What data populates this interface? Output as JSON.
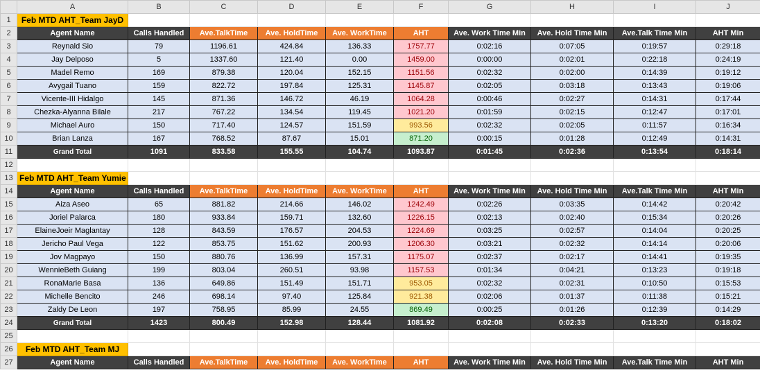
{
  "columns": [
    "A",
    "B",
    "C",
    "D",
    "E",
    "F",
    "G",
    "H",
    "I",
    "J"
  ],
  "headers": [
    "Agent Name",
    "Calls Handled",
    "Ave.TalkTime",
    "Ave. HoldTime",
    "Ave. WorkTime",
    "AHT",
    "Ave. Work Time Min",
    "Ave. Hold Time Min",
    "Ave.Talk Time Min",
    "AHT Min"
  ],
  "teams": [
    {
      "title": "Feb MTD AHT_Team JayD",
      "rows": [
        {
          "name": "Reynald Sio",
          "calls": "79",
          "talk": "1196.61",
          "hold": "424.84",
          "work": "136.33",
          "aht": "1757.77",
          "aht_status": "red",
          "work_min": "0:02:16",
          "hold_min": "0:07:05",
          "talk_min": "0:19:57",
          "aht_min": "0:29:18"
        },
        {
          "name": "Jay Delposo",
          "calls": "5",
          "talk": "1337.60",
          "hold": "121.40",
          "work": "0.00",
          "aht": "1459.00",
          "aht_status": "red",
          "work_min": "0:00:00",
          "hold_min": "0:02:01",
          "talk_min": "0:22:18",
          "aht_min": "0:24:19"
        },
        {
          "name": "Madel Remo",
          "calls": "169",
          "talk": "879.38",
          "hold": "120.04",
          "work": "152.15",
          "aht": "1151.56",
          "aht_status": "red",
          "work_min": "0:02:32",
          "hold_min": "0:02:00",
          "talk_min": "0:14:39",
          "aht_min": "0:19:12"
        },
        {
          "name": "Avygail Tuano",
          "calls": "159",
          "talk": "822.72",
          "hold": "197.84",
          "work": "125.31",
          "aht": "1145.87",
          "aht_status": "red",
          "work_min": "0:02:05",
          "hold_min": "0:03:18",
          "talk_min": "0:13:43",
          "aht_min": "0:19:06"
        },
        {
          "name": "Vicente-III Hidalgo",
          "calls": "145",
          "talk": "871.36",
          "hold": "146.72",
          "work": "46.19",
          "aht": "1064.28",
          "aht_status": "red",
          "work_min": "0:00:46",
          "hold_min": "0:02:27",
          "talk_min": "0:14:31",
          "aht_min": "0:17:44"
        },
        {
          "name": "Chezka-Alyanna Bilale",
          "calls": "217",
          "talk": "767.22",
          "hold": "134.54",
          "work": "119.45",
          "aht": "1021.20",
          "aht_status": "red",
          "work_min": "0:01:59",
          "hold_min": "0:02:15",
          "talk_min": "0:12:47",
          "aht_min": "0:17:01"
        },
        {
          "name": "Michael Auro",
          "calls": "150",
          "talk": "717.40",
          "hold": "124.57",
          "work": "151.59",
          "aht": "993.56",
          "aht_status": "yellow",
          "work_min": "0:02:32",
          "hold_min": "0:02:05",
          "talk_min": "0:11:57",
          "aht_min": "0:16:34"
        },
        {
          "name": "Brian Lanza",
          "calls": "167",
          "talk": "768.52",
          "hold": "87.67",
          "work": "15.01",
          "aht": "871.20",
          "aht_status": "green",
          "work_min": "0:00:15",
          "hold_min": "0:01:28",
          "talk_min": "0:12:49",
          "aht_min": "0:14:31"
        }
      ],
      "total": {
        "label": "Grand Total",
        "calls": "1091",
        "talk": "833.58",
        "hold": "155.55",
        "work": "104.74",
        "aht": "1093.87",
        "work_min": "0:01:45",
        "hold_min": "0:02:36",
        "talk_min": "0:13:54",
        "aht_min": "0:18:14"
      }
    },
    {
      "title": "Feb MTD AHT_Team Yumie",
      "rows": [
        {
          "name": "Aiza Aseo",
          "calls": "65",
          "talk": "881.82",
          "hold": "214.66",
          "work": "146.02",
          "aht": "1242.49",
          "aht_status": "red",
          "work_min": "0:02:26",
          "hold_min": "0:03:35",
          "talk_min": "0:14:42",
          "aht_min": "0:20:42"
        },
        {
          "name": "Joriel Palarca",
          "calls": "180",
          "talk": "933.84",
          "hold": "159.71",
          "work": "132.60",
          "aht": "1226.15",
          "aht_status": "red",
          "work_min": "0:02:13",
          "hold_min": "0:02:40",
          "talk_min": "0:15:34",
          "aht_min": "0:20:26"
        },
        {
          "name": "ElaineJoeir Maglantay",
          "calls": "128",
          "talk": "843.59",
          "hold": "176.57",
          "work": "204.53",
          "aht": "1224.69",
          "aht_status": "red",
          "work_min": "0:03:25",
          "hold_min": "0:02:57",
          "talk_min": "0:14:04",
          "aht_min": "0:20:25"
        },
        {
          "name": "Jericho Paul Vega",
          "calls": "122",
          "talk": "853.75",
          "hold": "151.62",
          "work": "200.93",
          "aht": "1206.30",
          "aht_status": "red",
          "work_min": "0:03:21",
          "hold_min": "0:02:32",
          "talk_min": "0:14:14",
          "aht_min": "0:20:06"
        },
        {
          "name": "Jov Magpayo",
          "calls": "150",
          "talk": "880.76",
          "hold": "136.99",
          "work": "157.31",
          "aht": "1175.07",
          "aht_status": "red",
          "work_min": "0:02:37",
          "hold_min": "0:02:17",
          "talk_min": "0:14:41",
          "aht_min": "0:19:35"
        },
        {
          "name": "WennieBeth Guiang",
          "calls": "199",
          "talk": "803.04",
          "hold": "260.51",
          "work": "93.98",
          "aht": "1157.53",
          "aht_status": "red",
          "work_min": "0:01:34",
          "hold_min": "0:04:21",
          "talk_min": "0:13:23",
          "aht_min": "0:19:18"
        },
        {
          "name": "RonaMarie Basa",
          "calls": "136",
          "talk": "649.86",
          "hold": "151.49",
          "work": "151.71",
          "aht": "953.05",
          "aht_status": "yellow",
          "work_min": "0:02:32",
          "hold_min": "0:02:31",
          "talk_min": "0:10:50",
          "aht_min": "0:15:53"
        },
        {
          "name": "Michelle Bencito",
          "calls": "246",
          "talk": "698.14",
          "hold": "97.40",
          "work": "125.84",
          "aht": "921.38",
          "aht_status": "yellow",
          "work_min": "0:02:06",
          "hold_min": "0:01:37",
          "talk_min": "0:11:38",
          "aht_min": "0:15:21"
        },
        {
          "name": "Zaldy De Leon",
          "calls": "197",
          "talk": "758.95",
          "hold": "85.99",
          "work": "24.55",
          "aht": "869.49",
          "aht_status": "green",
          "work_min": "0:00:25",
          "hold_min": "0:01:26",
          "talk_min": "0:12:39",
          "aht_min": "0:14:29"
        }
      ],
      "total": {
        "label": "Grand Total",
        "calls": "1423",
        "talk": "800.49",
        "hold": "152.98",
        "work": "128.44",
        "aht": "1081.92",
        "work_min": "0:02:08",
        "hold_min": "0:02:33",
        "talk_min": "0:13:20",
        "aht_min": "0:18:02"
      }
    },
    {
      "title": "Feb MTD AHT_Team MJ",
      "rows": [],
      "total": null
    }
  ],
  "colors": {
    "title_bg": "#ffc000",
    "header_dark": "#404040",
    "header_orange": "#ed7d31",
    "row_bg": "#dae3f3",
    "aht_red_bg": "#ffc7ce",
    "aht_yellow_bg": "#ffeb9c",
    "aht_green_bg": "#c6efce"
  }
}
